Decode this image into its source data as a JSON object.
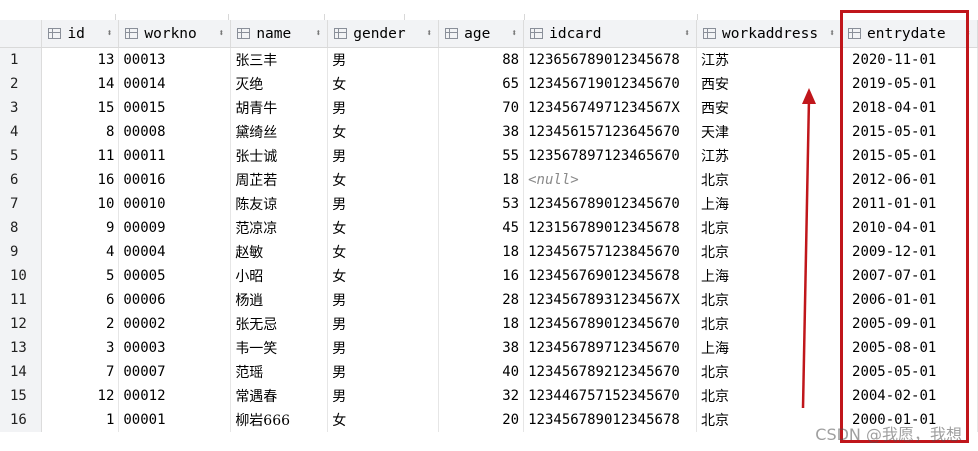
{
  "columns": [
    {
      "name": "id",
      "align": "right"
    },
    {
      "name": "workno",
      "align": "left"
    },
    {
      "name": "name",
      "align": "left"
    },
    {
      "name": "gender",
      "align": "left"
    },
    {
      "name": "age",
      "align": "right"
    },
    {
      "name": "idcard",
      "align": "left"
    },
    {
      "name": "workaddress",
      "align": "left"
    },
    {
      "name": "entrydate",
      "align": "left"
    }
  ],
  "sort_indicator": "⬍",
  "rows": [
    {
      "rn": "1",
      "id": "13",
      "workno": "00013",
      "name": "张三丰",
      "gender": "男",
      "age": "88",
      "idcard": "123656789012345678",
      "workaddress": "江苏",
      "entrydate": "2020-11-01"
    },
    {
      "rn": "2",
      "id": "14",
      "workno": "00014",
      "name": "灭绝",
      "gender": "女",
      "age": "65",
      "idcard": "123456719012345670",
      "workaddress": "西安",
      "entrydate": "2019-05-01"
    },
    {
      "rn": "3",
      "id": "15",
      "workno": "00015",
      "name": "胡青牛",
      "gender": "男",
      "age": "70",
      "idcard": "12345674971234567X",
      "workaddress": "西安",
      "entrydate": "2018-04-01"
    },
    {
      "rn": "4",
      "id": "8",
      "workno": "00008",
      "name": "黛绮丝",
      "gender": "女",
      "age": "38",
      "idcard": "123456157123645670",
      "workaddress": "天津",
      "entrydate": "2015-05-01"
    },
    {
      "rn": "5",
      "id": "11",
      "workno": "00011",
      "name": "张士诚",
      "gender": "男",
      "age": "55",
      "idcard": "123567897123465670",
      "workaddress": "江苏",
      "entrydate": "2015-05-01"
    },
    {
      "rn": "6",
      "id": "16",
      "workno": "00016",
      "name": "周芷若",
      "gender": "女",
      "age": "18",
      "idcard": "<null>",
      "workaddress": "北京",
      "entrydate": "2012-06-01"
    },
    {
      "rn": "7",
      "id": "10",
      "workno": "00010",
      "name": "陈友谅",
      "gender": "男",
      "age": "53",
      "idcard": "123456789012345670",
      "workaddress": "上海",
      "entrydate": "2011-01-01"
    },
    {
      "rn": "8",
      "id": "9",
      "workno": "00009",
      "name": "范凉凉",
      "gender": "女",
      "age": "45",
      "idcard": "123156789012345678",
      "workaddress": "北京",
      "entrydate": "2010-04-01"
    },
    {
      "rn": "9",
      "id": "4",
      "workno": "00004",
      "name": "赵敏",
      "gender": "女",
      "age": "18",
      "idcard": "123456757123845670",
      "workaddress": "北京",
      "entrydate": "2009-12-01"
    },
    {
      "rn": "10",
      "id": "5",
      "workno": "00005",
      "name": "小昭",
      "gender": "女",
      "age": "16",
      "idcard": "123456769012345678",
      "workaddress": "上海",
      "entrydate": "2007-07-01"
    },
    {
      "rn": "11",
      "id": "6",
      "workno": "00006",
      "name": "杨逍",
      "gender": "男",
      "age": "28",
      "idcard": "12345678931234567X",
      "workaddress": "北京",
      "entrydate": "2006-01-01"
    },
    {
      "rn": "12",
      "id": "2",
      "workno": "00002",
      "name": "张无忌",
      "gender": "男",
      "age": "18",
      "idcard": "123456789012345670",
      "workaddress": "北京",
      "entrydate": "2005-09-01"
    },
    {
      "rn": "13",
      "id": "3",
      "workno": "00003",
      "name": "韦一笑",
      "gender": "男",
      "age": "38",
      "idcard": "123456789712345670",
      "workaddress": "上海",
      "entrydate": "2005-08-01"
    },
    {
      "rn": "14",
      "id": "7",
      "workno": "00007",
      "name": "范瑶",
      "gender": "男",
      "age": "40",
      "idcard": "123456789212345670",
      "workaddress": "北京",
      "entrydate": "2005-05-01"
    },
    {
      "rn": "15",
      "id": "12",
      "workno": "00012",
      "name": "常遇春",
      "gender": "男",
      "age": "32",
      "idcard": "123446757152345670",
      "workaddress": "北京",
      "entrydate": "2004-02-01"
    },
    {
      "rn": "16",
      "id": "1",
      "workno": "00001",
      "name": "柳岩666",
      "gender": "女",
      "age": "20",
      "idcard": "123456789012345678",
      "workaddress": "北京",
      "entrydate": "2000-01-01"
    }
  ],
  "annotation": {
    "color": "#c0161b"
  },
  "watermark": "CSDN @我愿，我想"
}
